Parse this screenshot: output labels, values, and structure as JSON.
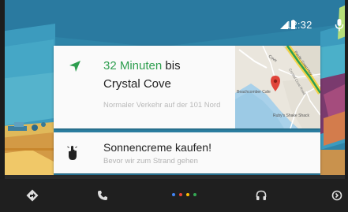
{
  "status_bar": {
    "time": "12:32"
  },
  "navigation_card": {
    "eta": "32 Minuten",
    "eta_suffix": "bis",
    "destination": "Crystal Cove",
    "traffic": "Normaler Verkehr auf der 101 Nord",
    "map_labels": {
      "cove": "Cove",
      "cafe": "Beachcomber Cafe",
      "shack": "Ruby's Shake Shack",
      "road_main": "Pacific Coast Hwy",
      "road_side": "Crystal Cove Road"
    }
  },
  "reminder_card": {
    "title": "Sonnencreme kaufen!",
    "subtitle": "Bevor wir zum Strand gehen"
  },
  "nav_bar": {
    "buttons": [
      "navigation-icon",
      "phone-icon",
      "home-dots-icon",
      "headphones-icon",
      "exit-icon"
    ],
    "dot_colors": [
      "#4285f4",
      "#ea4335",
      "#fbbc05",
      "#34a853"
    ]
  },
  "colors": {
    "accent_green": "#2e9e4f",
    "card": "#fafafa",
    "nav_bar": "#1f1f1f",
    "sky": "#2b7fa3"
  }
}
